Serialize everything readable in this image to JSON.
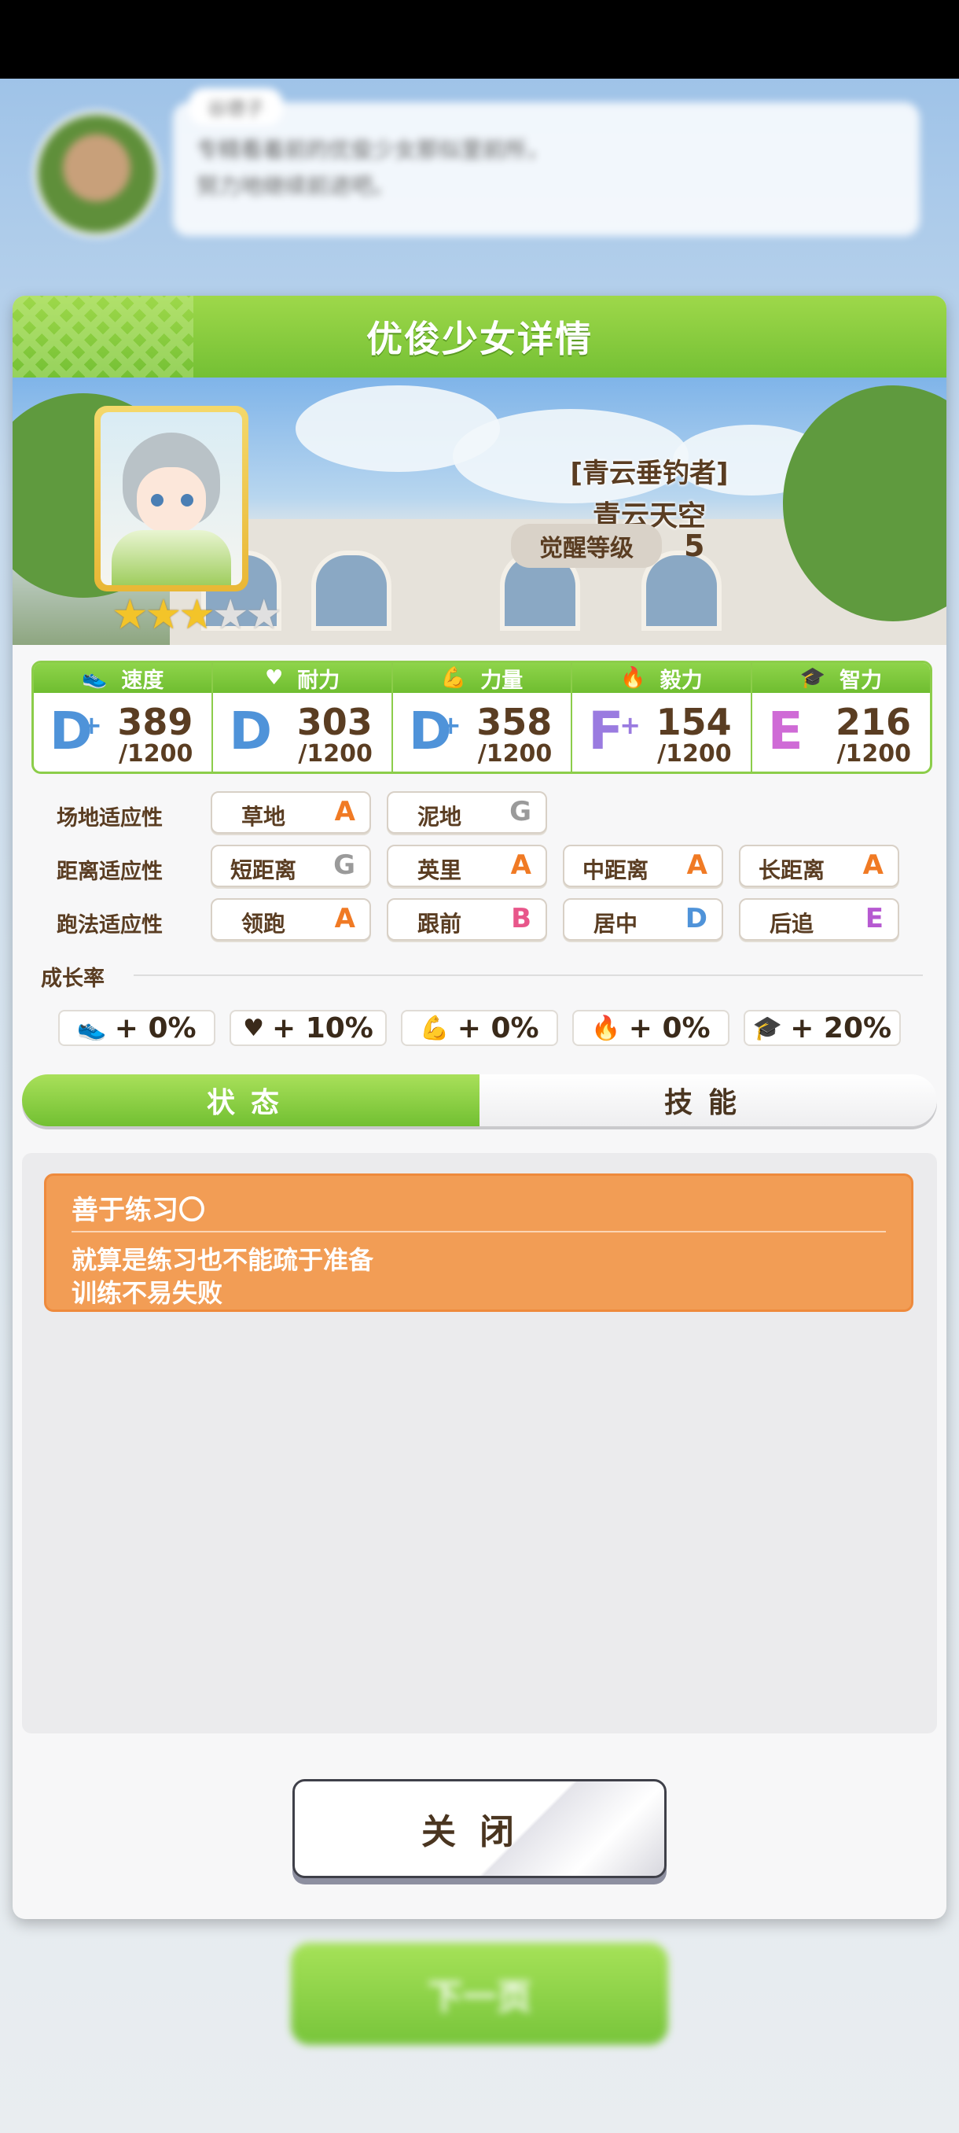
{
  "background": {
    "speaker_name": "谷德子",
    "dialogue_text": [
      "专精看着前的优俊少女那似里前所，",
      "努力地继续前进吧。"
    ],
    "next_button_label": "下一页"
  },
  "dialog": {
    "title": "优俊少女详情",
    "character": {
      "epithet": "[青云垂钓者]",
      "name": "青云天空",
      "awaken_label": "觉醒等级",
      "awaken_level": "5",
      "stars_filled": 3,
      "stars_total": 5
    },
    "stats": [
      {
        "icon": "shoe-icon",
        "label": "速度",
        "grade": "D",
        "plus": "+",
        "value": "389",
        "max": "/1200",
        "color": "#4f93d9"
      },
      {
        "icon": "heart-icon",
        "label": "耐力",
        "grade": "D",
        "plus": "",
        "value": "303",
        "max": "/1200",
        "color": "#4f93d9"
      },
      {
        "icon": "muscle-icon",
        "label": "力量",
        "grade": "D",
        "plus": "+",
        "value": "358",
        "max": "/1200",
        "color": "#4f93d9"
      },
      {
        "icon": "flame-icon",
        "label": "毅力",
        "grade": "F",
        "plus": "+",
        "value": "154",
        "max": "/1200",
        "color": "#9a7be0"
      },
      {
        "icon": "graduation-cap-icon",
        "label": "智力",
        "grade": "E",
        "plus": "",
        "value": "216",
        "max": "/1200",
        "color": "#cf6bd6"
      }
    ],
    "aptitude": {
      "track_label": "场地适应性",
      "track": [
        {
          "name": "草地",
          "grade": "A"
        },
        {
          "name": "泥地",
          "grade": "G"
        }
      ],
      "distance_label": "距离适应性",
      "distance": [
        {
          "name": "短距离",
          "grade": "G"
        },
        {
          "name": "英里",
          "grade": "A"
        },
        {
          "name": "中距离",
          "grade": "A"
        },
        {
          "name": "长距离",
          "grade": "A"
        }
      ],
      "style_label": "跑法适应性",
      "style": [
        {
          "name": "领跑",
          "grade": "A"
        },
        {
          "name": "跟前",
          "grade": "B"
        },
        {
          "name": "居中",
          "grade": "D"
        },
        {
          "name": "后追",
          "grade": "E"
        }
      ]
    },
    "growth": {
      "label": "成长率",
      "items": [
        {
          "icon": "shoe-icon",
          "text": "+ 0%"
        },
        {
          "icon": "heart-icon",
          "text": "+ 10%"
        },
        {
          "icon": "muscle-icon",
          "text": "+ 0%"
        },
        {
          "icon": "flame-icon",
          "text": "+ 0%"
        },
        {
          "icon": "graduation-cap-icon",
          "text": "+ 20%"
        }
      ]
    },
    "tabs": {
      "status": "状态",
      "skills": "技能",
      "active": "status"
    },
    "skill": {
      "name": "善于练习〇",
      "desc_line1": "就算是练习也不能疏于准备",
      "desc_line2": "训练不易失败"
    },
    "close_label": "关闭",
    "colors": {
      "header_green": "#74c034",
      "skill_orange": "#f29d55",
      "text_brown": "#5a3d22"
    }
  }
}
